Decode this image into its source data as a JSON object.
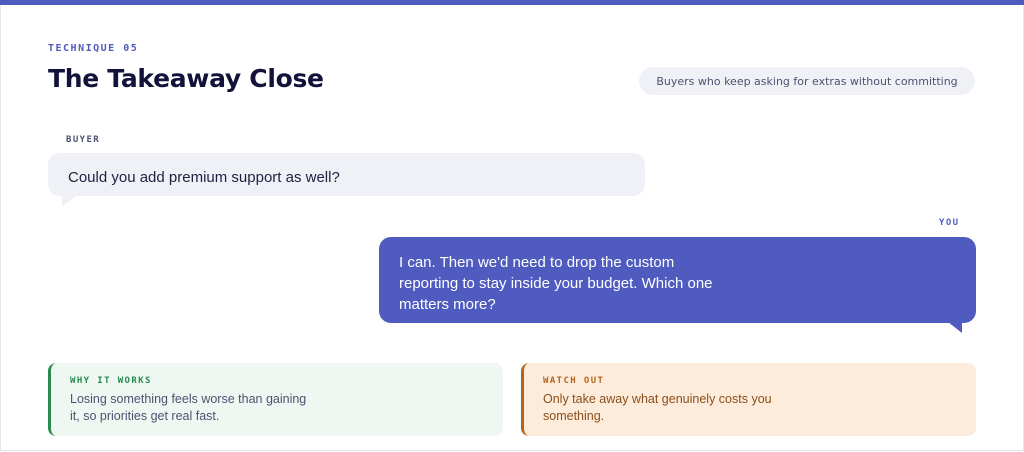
{
  "colors": {
    "accent": "#4f5bbf",
    "buyer_bubble": "#f0f1f6",
    "works_green": "#2a8a4f",
    "watch_orange": "#b4651c"
  },
  "header": {
    "eyebrow": "TECHNIQUE 05",
    "title": "The Takeaway Close",
    "tag": "Buyers who keep asking for extras without committing"
  },
  "dialogue": {
    "buyer_label": "BUYER",
    "buyer_text": "Could you add premium support as well?",
    "you_label": "YOU",
    "you_text": "I can. Then we'd need to drop the custom reporting to stay inside your budget. Which one matters more?"
  },
  "cards": {
    "works_title": "WHY IT WORKS",
    "works_text": "Losing something feels worse than gaining it, so priorities get real fast.",
    "watch_title": "WATCH OUT",
    "watch_text": "Only take away what genuinely costs you something."
  }
}
